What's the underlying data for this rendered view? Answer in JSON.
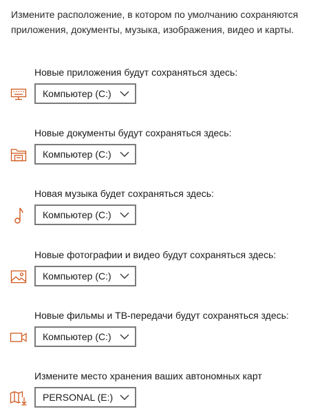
{
  "intro_text": "Измените расположение, в котором по умолчанию сохраняются приложения, документы, музыка, изображения, видео и карты.",
  "accent_color": "#d0581c",
  "locations": [
    {
      "label": "Новые приложения будут сохраняться здесь:",
      "icon": "keyboard-icon",
      "value": "Компьютер (C:)"
    },
    {
      "label": "Новые документы будут сохраняться здесь:",
      "icon": "document-folder-icon",
      "value": "Компьютер (C:)"
    },
    {
      "label": "Новая музыка будет сохраняться здесь:",
      "icon": "music-note-icon",
      "value": "Компьютер (C:)"
    },
    {
      "label": "Новые фотографии и видео будут сохраняться здесь:",
      "icon": "picture-icon",
      "value": "Компьютер (C:)"
    },
    {
      "label": "Новые фильмы и ТВ-передачи будут сохраняться здесь:",
      "icon": "video-camera-icon",
      "value": "Компьютер (C:)"
    },
    {
      "label": "Измените место хранения ваших автономных карт",
      "icon": "map-download-icon",
      "value": "PERSONAL (E:)"
    }
  ]
}
